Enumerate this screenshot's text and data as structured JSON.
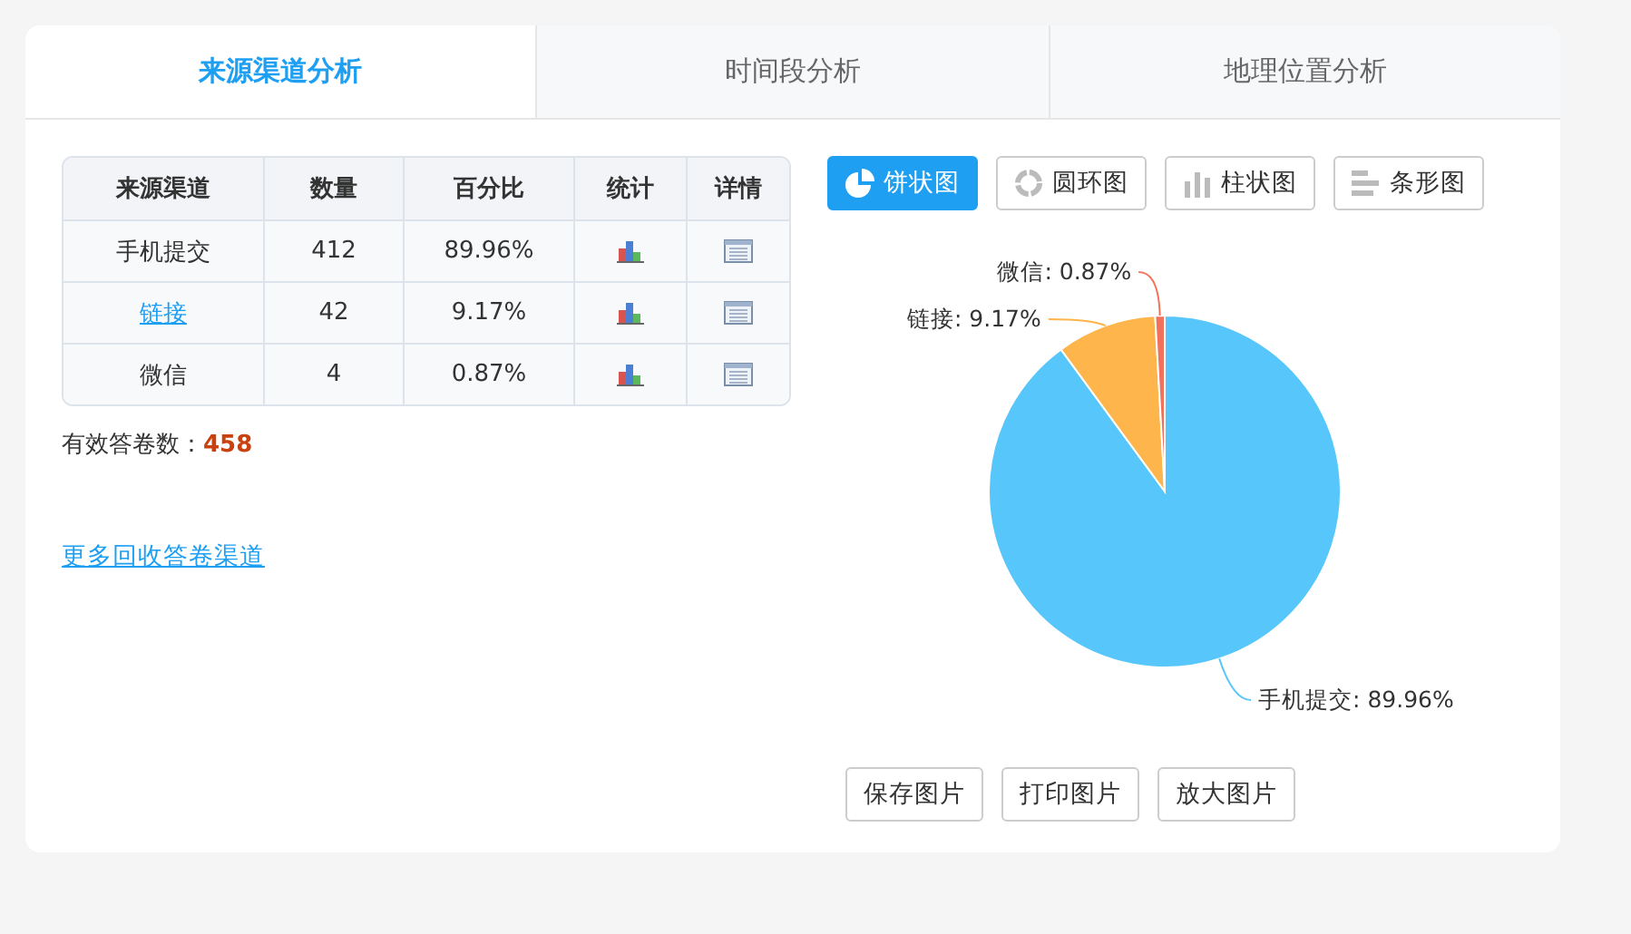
{
  "tabs": [
    {
      "label": "来源渠道分析",
      "selected": true
    },
    {
      "label": "时间段分析",
      "selected": false
    },
    {
      "label": "地理位置分析",
      "selected": false
    }
  ],
  "table": {
    "columns": [
      "来源渠道",
      "数量",
      "百分比",
      "统计",
      "详情"
    ],
    "rows": [
      {
        "channel": "手机提交",
        "link": false,
        "count": "412",
        "percent": "89.96%"
      },
      {
        "channel": "链接",
        "link": true,
        "count": "42",
        "percent": "9.17%"
      },
      {
        "channel": "微信",
        "link": false,
        "count": "4",
        "percent": "0.87%"
      }
    ]
  },
  "total": {
    "label": "有效答卷数：",
    "value": "458"
  },
  "more_link": "更多回收答卷渠道",
  "chart_types": [
    {
      "kind": "pie",
      "label": "饼状图",
      "selected": true
    },
    {
      "kind": "ring",
      "label": "圆环图",
      "selected": false
    },
    {
      "kind": "column",
      "label": "柱状图",
      "selected": false
    },
    {
      "kind": "bar",
      "label": "条形图",
      "selected": false
    }
  ],
  "chart_data": {
    "type": "pie",
    "values": [
      89.96,
      9.17,
      0.87
    ],
    "colors": [
      "#56c6fb",
      "#fdb54c",
      "#f2715a"
    ],
    "value_labels": [
      "手机提交: 89.96%",
      "链接: 9.17%",
      "微信: 0.87%"
    ]
  },
  "actions": [
    "保存图片",
    "打印图片",
    "放大图片"
  ]
}
